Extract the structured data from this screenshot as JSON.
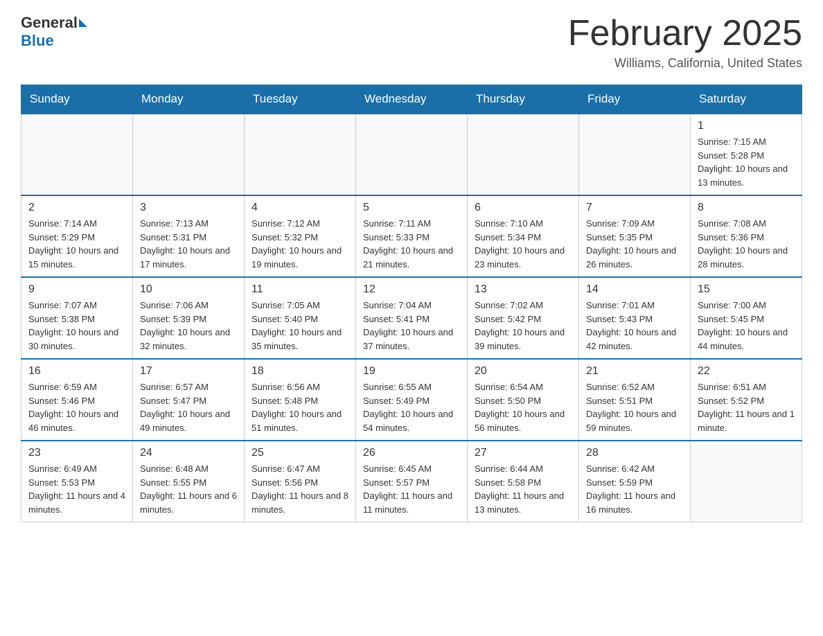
{
  "logo": {
    "general": "General",
    "blue": "Blue"
  },
  "title": {
    "month_year": "February 2025",
    "location": "Williams, California, United States"
  },
  "weekdays": [
    "Sunday",
    "Monday",
    "Tuesday",
    "Wednesday",
    "Thursday",
    "Friday",
    "Saturday"
  ],
  "weeks": [
    [
      {
        "day": "",
        "info": ""
      },
      {
        "day": "",
        "info": ""
      },
      {
        "day": "",
        "info": ""
      },
      {
        "day": "",
        "info": ""
      },
      {
        "day": "",
        "info": ""
      },
      {
        "day": "",
        "info": ""
      },
      {
        "day": "1",
        "info": "Sunrise: 7:15 AM\nSunset: 5:28 PM\nDaylight: 10 hours and 13 minutes."
      }
    ],
    [
      {
        "day": "2",
        "info": "Sunrise: 7:14 AM\nSunset: 5:29 PM\nDaylight: 10 hours and 15 minutes."
      },
      {
        "day": "3",
        "info": "Sunrise: 7:13 AM\nSunset: 5:31 PM\nDaylight: 10 hours and 17 minutes."
      },
      {
        "day": "4",
        "info": "Sunrise: 7:12 AM\nSunset: 5:32 PM\nDaylight: 10 hours and 19 minutes."
      },
      {
        "day": "5",
        "info": "Sunrise: 7:11 AM\nSunset: 5:33 PM\nDaylight: 10 hours and 21 minutes."
      },
      {
        "day": "6",
        "info": "Sunrise: 7:10 AM\nSunset: 5:34 PM\nDaylight: 10 hours and 23 minutes."
      },
      {
        "day": "7",
        "info": "Sunrise: 7:09 AM\nSunset: 5:35 PM\nDaylight: 10 hours and 26 minutes."
      },
      {
        "day": "8",
        "info": "Sunrise: 7:08 AM\nSunset: 5:36 PM\nDaylight: 10 hours and 28 minutes."
      }
    ],
    [
      {
        "day": "9",
        "info": "Sunrise: 7:07 AM\nSunset: 5:38 PM\nDaylight: 10 hours and 30 minutes."
      },
      {
        "day": "10",
        "info": "Sunrise: 7:06 AM\nSunset: 5:39 PM\nDaylight: 10 hours and 32 minutes."
      },
      {
        "day": "11",
        "info": "Sunrise: 7:05 AM\nSunset: 5:40 PM\nDaylight: 10 hours and 35 minutes."
      },
      {
        "day": "12",
        "info": "Sunrise: 7:04 AM\nSunset: 5:41 PM\nDaylight: 10 hours and 37 minutes."
      },
      {
        "day": "13",
        "info": "Sunrise: 7:02 AM\nSunset: 5:42 PM\nDaylight: 10 hours and 39 minutes."
      },
      {
        "day": "14",
        "info": "Sunrise: 7:01 AM\nSunset: 5:43 PM\nDaylight: 10 hours and 42 minutes."
      },
      {
        "day": "15",
        "info": "Sunrise: 7:00 AM\nSunset: 5:45 PM\nDaylight: 10 hours and 44 minutes."
      }
    ],
    [
      {
        "day": "16",
        "info": "Sunrise: 6:59 AM\nSunset: 5:46 PM\nDaylight: 10 hours and 46 minutes."
      },
      {
        "day": "17",
        "info": "Sunrise: 6:57 AM\nSunset: 5:47 PM\nDaylight: 10 hours and 49 minutes."
      },
      {
        "day": "18",
        "info": "Sunrise: 6:56 AM\nSunset: 5:48 PM\nDaylight: 10 hours and 51 minutes."
      },
      {
        "day": "19",
        "info": "Sunrise: 6:55 AM\nSunset: 5:49 PM\nDaylight: 10 hours and 54 minutes."
      },
      {
        "day": "20",
        "info": "Sunrise: 6:54 AM\nSunset: 5:50 PM\nDaylight: 10 hours and 56 minutes."
      },
      {
        "day": "21",
        "info": "Sunrise: 6:52 AM\nSunset: 5:51 PM\nDaylight: 10 hours and 59 minutes."
      },
      {
        "day": "22",
        "info": "Sunrise: 6:51 AM\nSunset: 5:52 PM\nDaylight: 11 hours and 1 minute."
      }
    ],
    [
      {
        "day": "23",
        "info": "Sunrise: 6:49 AM\nSunset: 5:53 PM\nDaylight: 11 hours and 4 minutes."
      },
      {
        "day": "24",
        "info": "Sunrise: 6:48 AM\nSunset: 5:55 PM\nDaylight: 11 hours and 6 minutes."
      },
      {
        "day": "25",
        "info": "Sunrise: 6:47 AM\nSunset: 5:56 PM\nDaylight: 11 hours and 8 minutes."
      },
      {
        "day": "26",
        "info": "Sunrise: 6:45 AM\nSunset: 5:57 PM\nDaylight: 11 hours and 11 minutes."
      },
      {
        "day": "27",
        "info": "Sunrise: 6:44 AM\nSunset: 5:58 PM\nDaylight: 11 hours and 13 minutes."
      },
      {
        "day": "28",
        "info": "Sunrise: 6:42 AM\nSunset: 5:59 PM\nDaylight: 11 hours and 16 minutes."
      },
      {
        "day": "",
        "info": ""
      }
    ]
  ]
}
